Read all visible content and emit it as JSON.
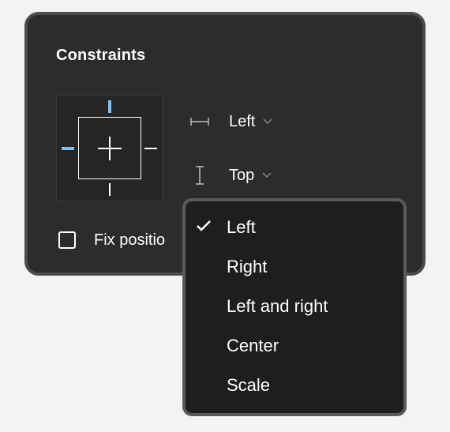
{
  "panel": {
    "title": "Constraints",
    "horizontal": {
      "value": "Left",
      "icon": "horizontal-constraint-icon"
    },
    "vertical": {
      "value": "Top",
      "icon": "vertical-constraint-icon"
    },
    "fix_position": {
      "label": "Fix positio",
      "checked": false
    }
  },
  "widget": {
    "active_sides": [
      "top",
      "left"
    ],
    "accent_color": "#80c0f2"
  },
  "dropdown": {
    "selected": "Left",
    "items": [
      {
        "label": "Left",
        "checked": true
      },
      {
        "label": "Right",
        "checked": false
      },
      {
        "label": "Left and right",
        "checked": false
      },
      {
        "label": "Center",
        "checked": false
      },
      {
        "label": "Scale",
        "checked": false
      }
    ]
  },
  "colors": {
    "panel_bg": "#2c2c2c",
    "menu_bg": "#1e1e1e",
    "text": "#ffffff",
    "accent": "#80c0f2"
  }
}
